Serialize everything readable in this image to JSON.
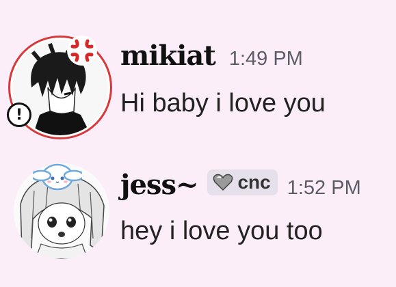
{
  "messages": [
    {
      "username": "mikiat",
      "timestamp": "1:49 PM",
      "text": "Hi baby i love you",
      "avatar_icon": "anime-boy-avatar",
      "decorations": [
        "anger-vein-icon",
        "exclamation-badge-icon"
      ],
      "ring_color": "#d73a3a"
    },
    {
      "username": "jess~",
      "role": {
        "label": "cnc",
        "icon": "heart-icon"
      },
      "timestamp": "1:52 PM",
      "text": "hey i love you too",
      "avatar_icon": "anime-girl-avatar",
      "decorations": [
        "cinnamoroll-icon"
      ]
    }
  ],
  "colors": {
    "background": "#fbeef9",
    "username": "#111111",
    "timestamp": "#5c5c66",
    "badge_bg": "#e6e0ea"
  }
}
